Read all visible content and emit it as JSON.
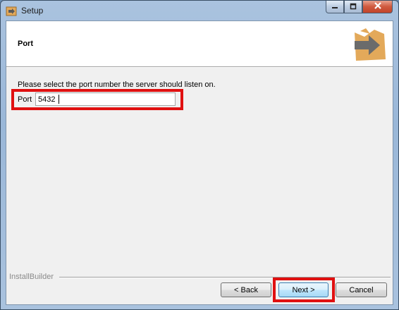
{
  "window": {
    "title": "Setup",
    "icon": "installer-box-icon"
  },
  "header": {
    "title": "Port",
    "logo": "installer-arrow-logo"
  },
  "main": {
    "instruction": "Please select the port number the server should listen on.",
    "port_label": "Port",
    "port_value": "5432"
  },
  "footer": {
    "brand": "InstallBuilder",
    "back_label": "< Back",
    "next_label": "Next >",
    "cancel_label": "Cancel"
  },
  "colors": {
    "highlight": "#e01010",
    "titlebar": "#9ab7d8",
    "logo_box": "#e3a95a",
    "logo_arrow": "#6b6b6b"
  }
}
